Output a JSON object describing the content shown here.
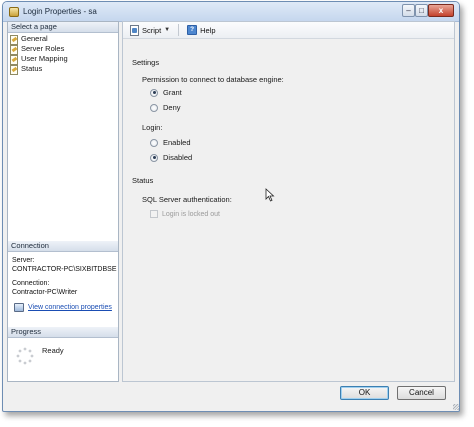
{
  "window": {
    "title": "Login Properties - sa"
  },
  "window_controls": {
    "minimize": "–",
    "maximize": "□",
    "close": "x"
  },
  "left_panel": {
    "select_page_header": "Select a page",
    "pages": [
      {
        "label": "General",
        "icon": "page-icon"
      },
      {
        "label": "Server Roles",
        "icon": "page-icon"
      },
      {
        "label": "User Mapping",
        "icon": "page-icon"
      },
      {
        "label": "Status",
        "icon": "page-icon"
      }
    ],
    "connection": {
      "header": "Connection",
      "server_label": "Server:",
      "server_value": "CONTRACTOR-PC\\SIXBITDBSE",
      "connection_label": "Connection:",
      "connection_value": "Contractor-PC\\Writer",
      "view_link": "View connection properties"
    },
    "progress": {
      "header": "Progress",
      "status": "Ready"
    }
  },
  "toolbar": {
    "script_label": "Script",
    "help_label": "Help"
  },
  "settings": {
    "heading": "Settings",
    "permission_label": "Permission to connect to database engine:",
    "permission_options": [
      {
        "label": "Grant",
        "checked": true
      },
      {
        "label": "Deny",
        "checked": false
      }
    ],
    "login_label": "Login:",
    "login_options": [
      {
        "label": "Enabled",
        "checked": false
      },
      {
        "label": "Disabled",
        "checked": true
      }
    ]
  },
  "status": {
    "heading": "Status",
    "sql_auth_label": "SQL Server authentication:",
    "locked_out_label": "Login is locked out",
    "locked_out_checked": false
  },
  "buttons": {
    "ok": "OK",
    "cancel": "Cancel"
  }
}
